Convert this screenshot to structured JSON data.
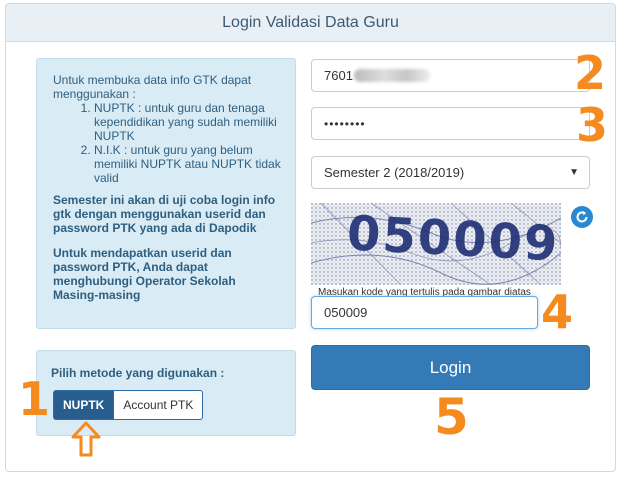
{
  "header": {
    "title": "Login Validasi Data Guru"
  },
  "info": {
    "intro": "Untuk membuka data info GTK dapat menggunakan :",
    "items": [
      "NUPTK : untuk guru dan tenaga kependidikan yang sudah memiliki NUPTK",
      "N.I.K : untuk guru yang belum memiliki NUPTK atau NUPTK tidak valid"
    ],
    "note1": "Semester ini akan di uji coba login info gtk dengan menggunakan userid dan password PTK yang ada di Dapodik",
    "note2": "Untuk mendapatkan userid dan password PTK, Anda dapat menghubungi Operator Sekolah Masing-masing"
  },
  "method": {
    "label": "Pilih metode yang digunakan :",
    "options": [
      "NUPTK",
      "Account PTK"
    ],
    "selected": "NUPTK"
  },
  "form": {
    "userid_value": "7601",
    "password_value": "••••••••",
    "semester_selected": "Semester 2 (2018/2019)",
    "captcha_text": "050009",
    "captcha_hint": "Masukan kode yang tertulis pada gambar diatas",
    "captcha_value": "050009",
    "login_label": "Login"
  },
  "annotations": {
    "n1": "1",
    "n2": "2",
    "n3": "3",
    "n4": "4",
    "n5": "5",
    "color": "#f58a1f"
  }
}
